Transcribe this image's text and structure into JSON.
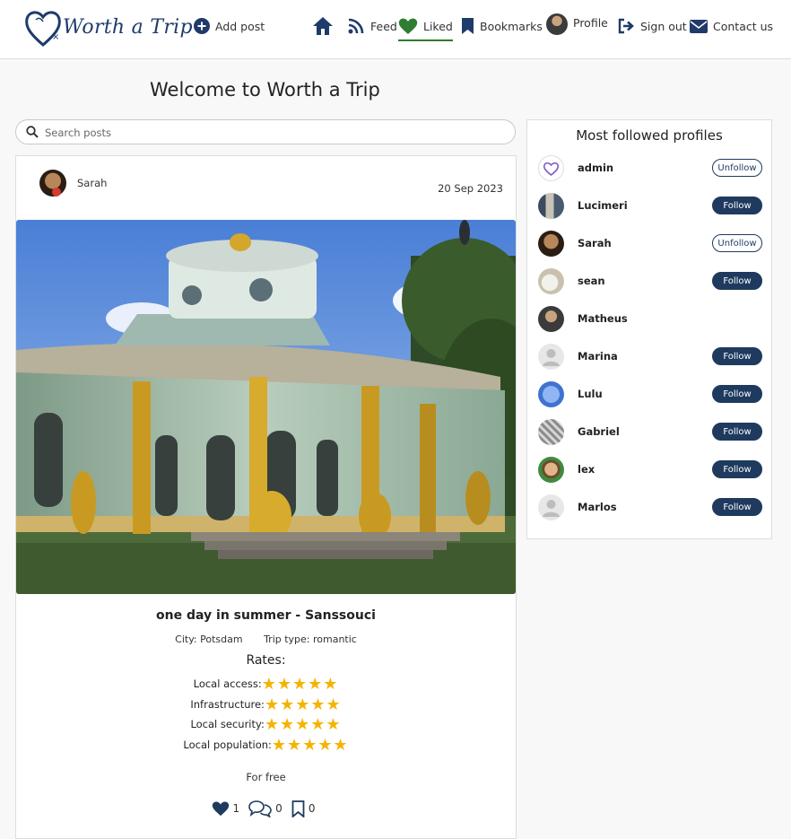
{
  "navbar": {
    "logo_text": "Worth a Trip",
    "add_post": "Add post",
    "feed": "Feed",
    "liked": "Liked",
    "bookmarks": "Bookmarks",
    "profile": "Profile",
    "sign_out": "Sign out",
    "contact": "Contact us",
    "active_item": "liked",
    "colors": {
      "brand": "#1f3b6b",
      "liked_green": "#2e7d32"
    }
  },
  "main": {
    "title": "Welcome to Worth a Trip",
    "search": {
      "placeholder": "Search posts",
      "value": ""
    }
  },
  "post": {
    "author": "Sarah",
    "date": "20 Sep 2023",
    "image_description_icon": "sanssouci-chinese-house-photo",
    "title": "one day in summer - Sanssouci",
    "city": "City: Potsdam",
    "trip_type": "Trip type: romantic",
    "rates_title": "Rates:",
    "rates": [
      {
        "label": "Local access:",
        "stars": "★★★★★",
        "value": 5
      },
      {
        "label": "Infrastructure:",
        "stars": "★★★★★",
        "value": 5
      },
      {
        "label": "Local security:",
        "stars": "★★★★★",
        "value": 5
      },
      {
        "label": "Local population:",
        "stars": "★★★★★",
        "value": 5
      }
    ],
    "price": "For free",
    "likes": "1",
    "comments": "0",
    "bookmarks": "0",
    "colors": {
      "star": "#f5b301",
      "heart": "#1f3a5f"
    }
  },
  "sidebar": {
    "title": "Most followed profiles",
    "profiles": [
      {
        "name": "admin",
        "button": "Unfollow"
      },
      {
        "name": "Lucimeri",
        "button": "Follow"
      },
      {
        "name": "Sarah",
        "button": "Unfollow"
      },
      {
        "name": "sean",
        "button": "Follow"
      },
      {
        "name": "Matheus",
        "button": ""
      },
      {
        "name": "Marina",
        "button": "Follow"
      },
      {
        "name": "Lulu",
        "button": "Follow"
      },
      {
        "name": "Gabriel",
        "button": "Follow"
      },
      {
        "name": "lex",
        "button": "Follow"
      },
      {
        "name": "Marlos",
        "button": "Follow"
      }
    ],
    "colors": {
      "follow_bg": "#1f3a5f"
    }
  }
}
